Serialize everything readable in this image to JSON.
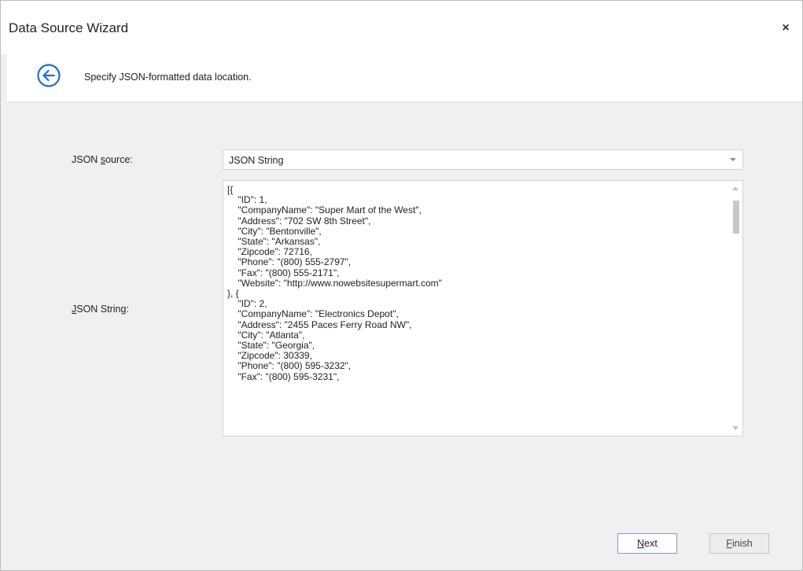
{
  "window": {
    "title": "Data Source Wizard",
    "close_glyph": "×"
  },
  "header": {
    "back_icon": "circle-arrow-left-icon",
    "description": "Specify JSON-formatted data location."
  },
  "form": {
    "source_label_prefix": "JSON ",
    "source_label_mnemonic": "s",
    "source_label_suffix": "ource:",
    "source_value": "JSON String",
    "string_label_mnemonic": "J",
    "string_label_suffix": "SON String:",
    "json_text": "[{\n    \"ID\": 1,\n    \"CompanyName\": \"Super Mart of the West\",\n    \"Address\": \"702 SW 8th Street\",\n    \"City\": \"Bentonville\",\n    \"State\": \"Arkansas\",\n    \"Zipcode\": 72716,\n    \"Phone\": \"(800) 555-2797\",\n    \"Fax\": \"(800) 555-2171\",\n    \"Website\": \"http://www.nowebsitesupermart.com\"\n}, {\n    \"ID\": 2,\n    \"CompanyName\": \"Electronics Depot\",\n    \"Address\": \"2455 Paces Ferry Road NW\",\n    \"City\": \"Atlanta\",\n    \"State\": \"Georgia\",\n    \"Zipcode\": 30339,\n    \"Phone\": \"(800) 595-3232\",\n    \"Fax\": \"(800) 595-3231\","
  },
  "buttons": {
    "next_mnemonic": "N",
    "next_suffix": "ext",
    "finish_mnemonic": "F",
    "finish_suffix": "inish"
  },
  "colors": {
    "accent": "#1e6fc8",
    "window_bg": "#f0f0f0",
    "header_bg": "#ffffff"
  }
}
